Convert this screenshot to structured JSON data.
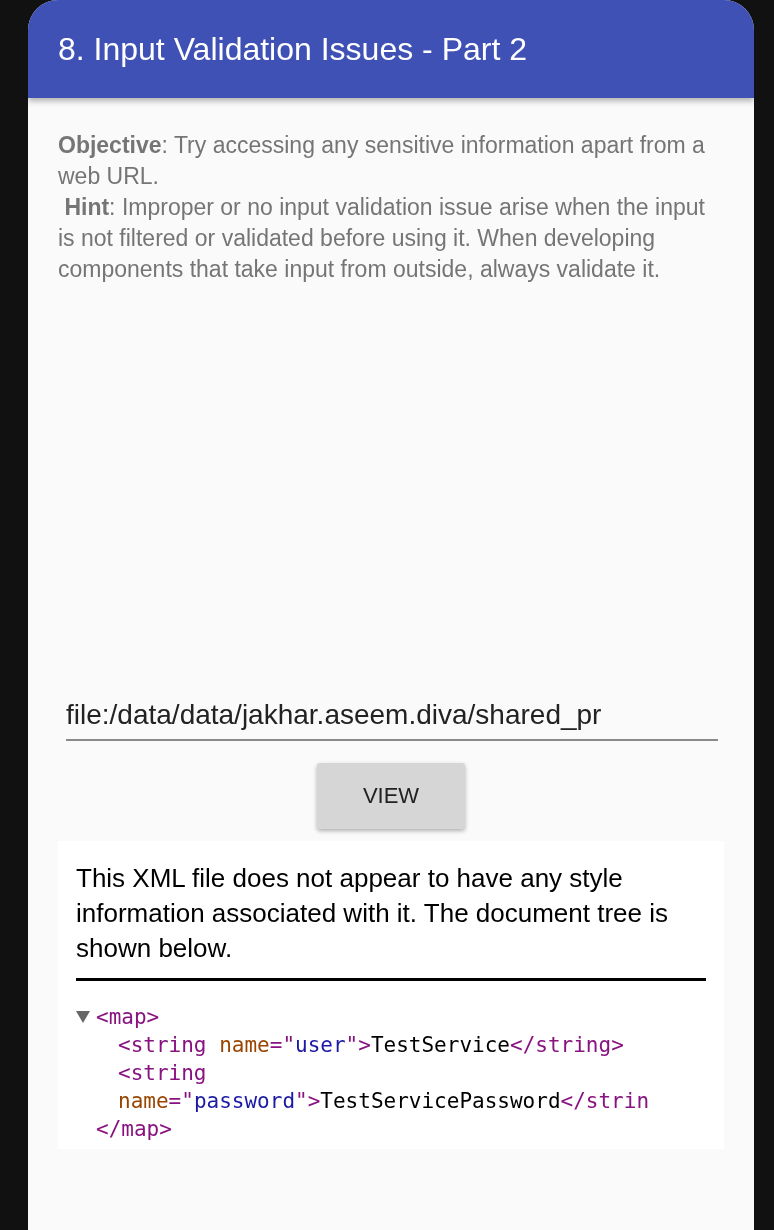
{
  "app_bar": {
    "title": "8. Input Validation Issues - Part 2"
  },
  "description": {
    "objective_label": "Objective",
    "objective": ": Try accessing any sensitive information apart from a web URL.",
    "hint_label": "Hint",
    "hint": ": Improper or no input validation issue arise when the input is not filtered or validated before using it. When developing components that take input from outside, always validate it."
  },
  "url_field": {
    "value": "file:/data/data/jakhar.aseem.diva/shared_pr"
  },
  "view_button": {
    "label": "VIEW"
  },
  "xml_viewer": {
    "notice": "This XML file does not appear to have any style information associated with it. The document tree is shown below.",
    "tree": {
      "expanded": true,
      "open": "<map>",
      "close": "</map>",
      "children": [
        {
          "lines": [
            [
              {
                "kind": "tag",
                "text": "<string "
              },
              {
                "kind": "attr",
                "text": "name"
              },
              {
                "kind": "tag",
                "text": "=\""
              },
              {
                "kind": "value",
                "text": "user"
              },
              {
                "kind": "tag",
                "text": "\">"
              },
              {
                "kind": "text",
                "text": "TestService"
              },
              {
                "kind": "tag",
                "text": "</string>"
              }
            ]
          ]
        },
        {
          "lines": [
            [
              {
                "kind": "tag",
                "text": "<string"
              }
            ],
            [
              {
                "kind": "attr",
                "text": "name"
              },
              {
                "kind": "tag",
                "text": "=\""
              },
              {
                "kind": "value",
                "text": "password"
              },
              {
                "kind": "tag",
                "text": "\">"
              },
              {
                "kind": "text",
                "text": "TestServicePassword"
              },
              {
                "kind": "tag",
                "text": "</strin"
              }
            ]
          ]
        }
      ]
    }
  }
}
